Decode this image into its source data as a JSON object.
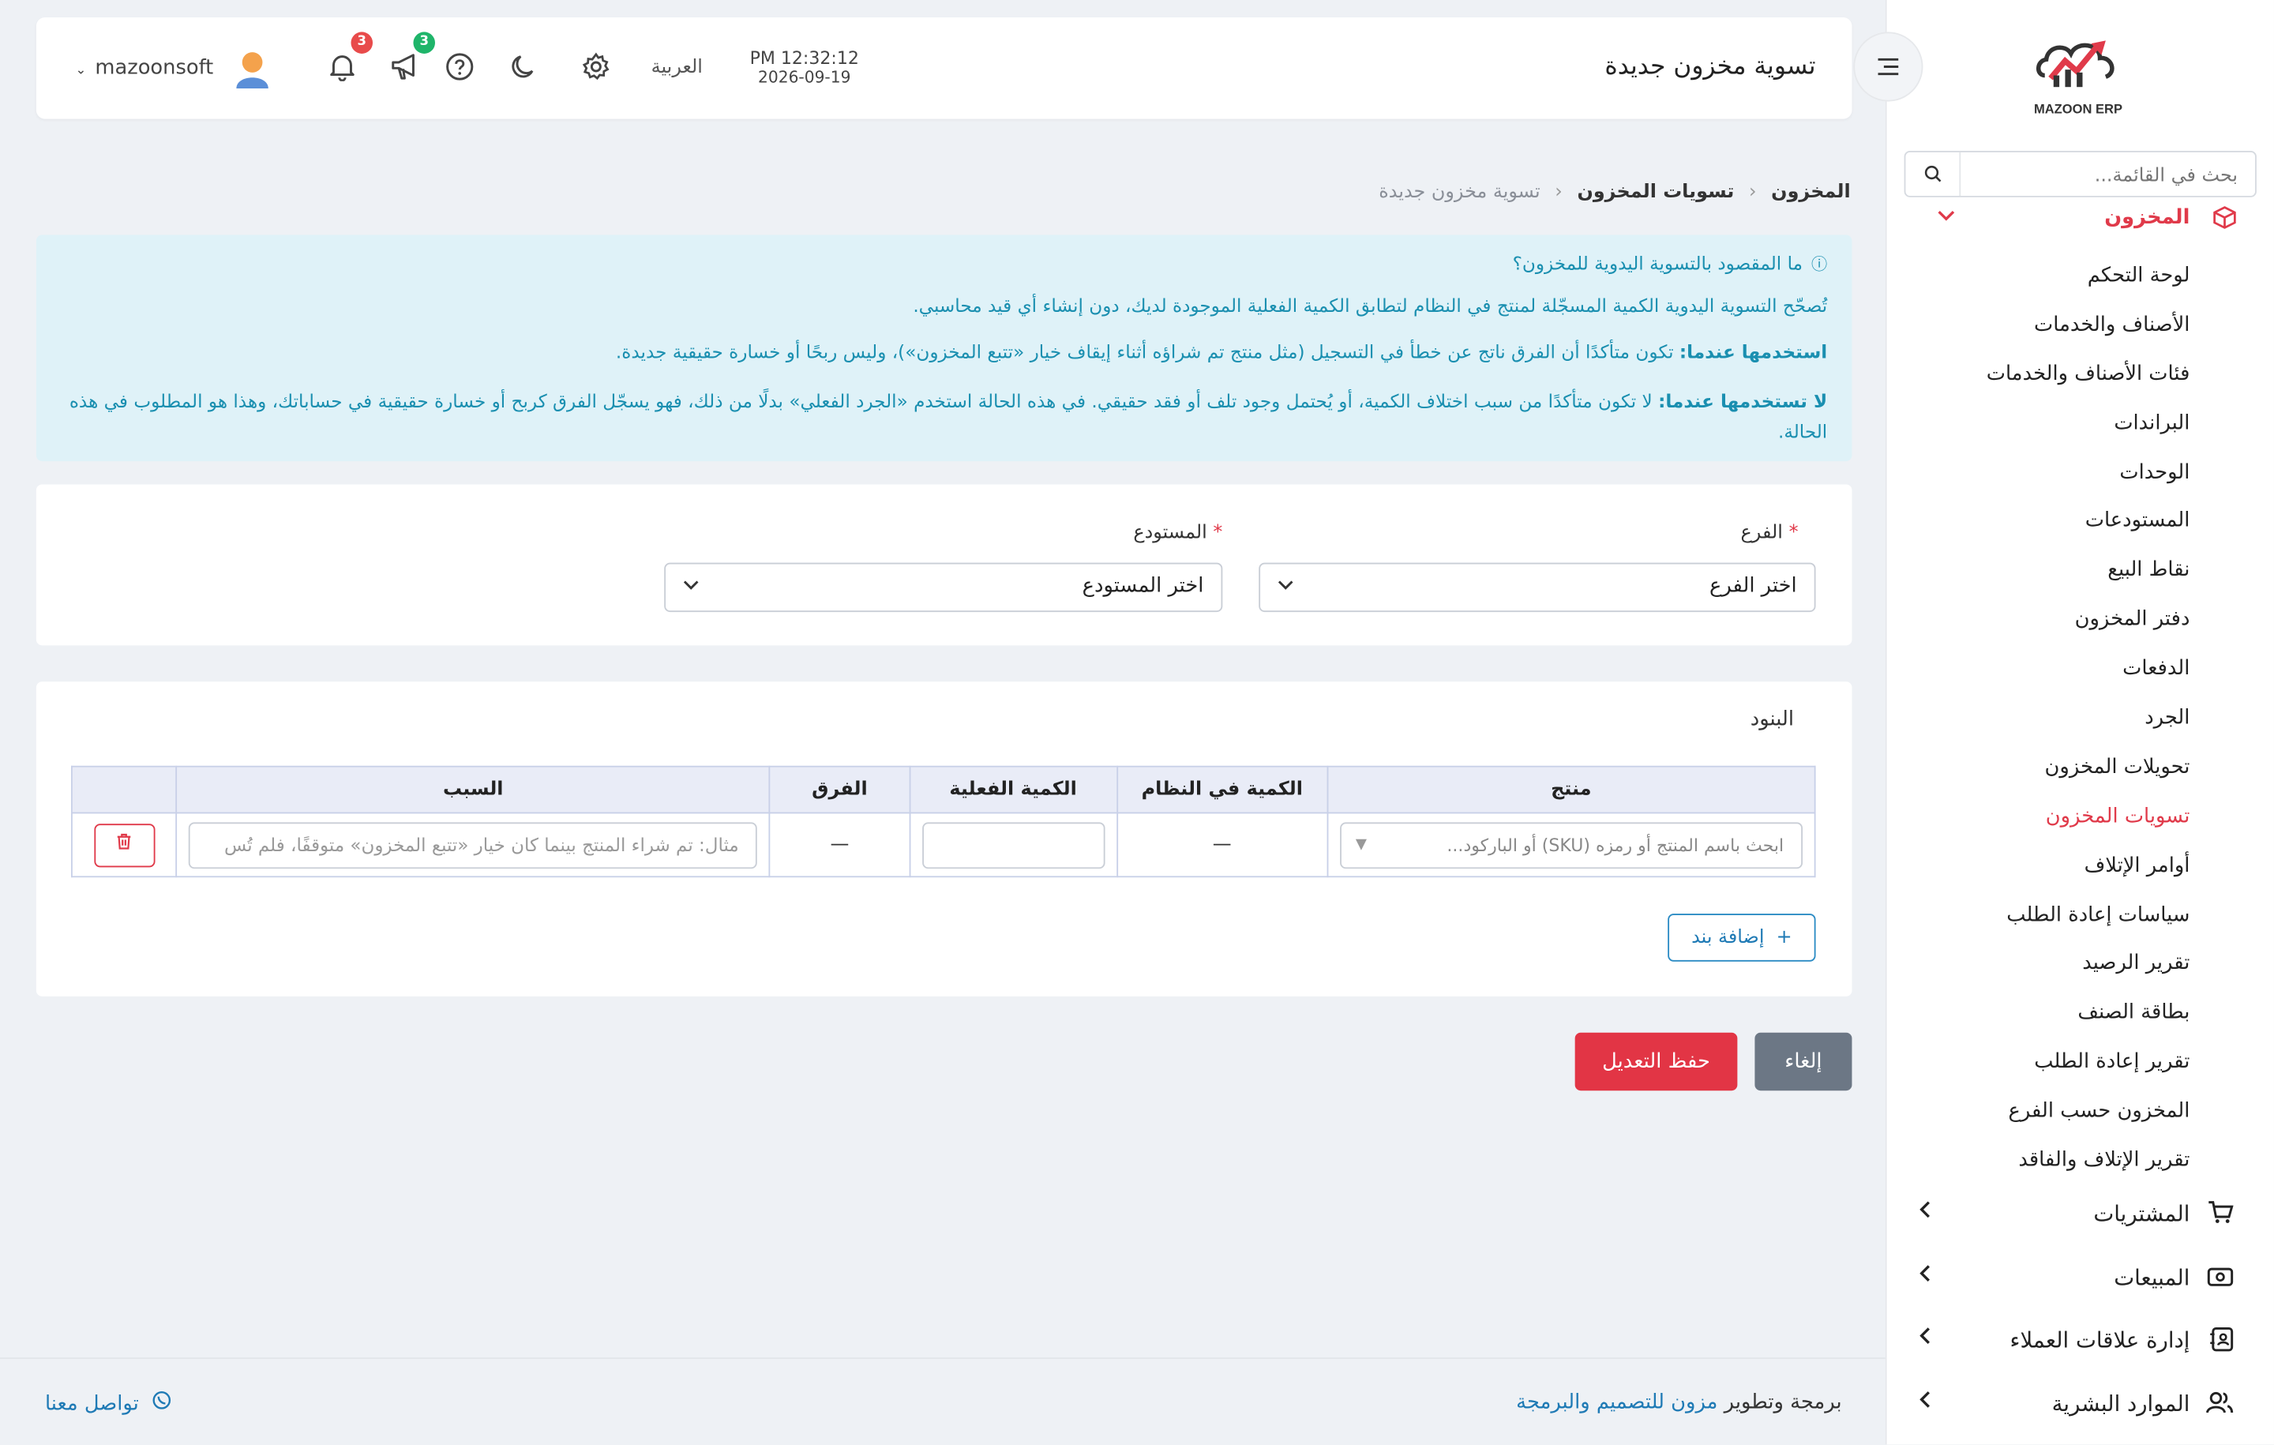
{
  "app": {
    "logo_text": "MAZOON ERP",
    "logo_sub": "ERP"
  },
  "sidebar": {
    "search_placeholder": "بحث في القائمة...",
    "section_title": "المخزون",
    "items": [
      {
        "label": "لوحة التحكم"
      },
      {
        "label": "الأصناف والخدمات"
      },
      {
        "label": "فئات الأصناف والخدمات"
      },
      {
        "label": "البراندات"
      },
      {
        "label": "الوحدات"
      },
      {
        "label": "المستودعات"
      },
      {
        "label": "نقاط البيع"
      },
      {
        "label": "دفتر المخزون"
      },
      {
        "label": "الدفعات"
      },
      {
        "label": "الجرد"
      },
      {
        "label": "تحويلات المخزون"
      },
      {
        "label": "تسويات المخزون"
      },
      {
        "label": "أوامر الإتلاف"
      },
      {
        "label": "سياسات إعادة الطلب"
      },
      {
        "label": "تقرير الرصيد"
      },
      {
        "label": "بطاقة الصنف"
      },
      {
        "label": "تقرير إعادة الطلب"
      },
      {
        "label": "المخزون حسب الفرع"
      },
      {
        "label": "تقرير الإتلاف والفاقد"
      }
    ],
    "active_item": "تسويات المخزون",
    "groups": [
      {
        "label": "المشتريات"
      },
      {
        "label": "المبيعات"
      },
      {
        "label": "إدارة علاقات العملاء"
      },
      {
        "label": "الموارد البشرية"
      }
    ]
  },
  "header": {
    "title": "تسوية مخزون جديدة",
    "time": "PM 12:32:12",
    "date": "2026-09-19",
    "language": "العربية",
    "announcements_count": "3",
    "notifications_count": "3",
    "username": "mazoonsoft"
  },
  "breadcrumb": {
    "level1": "المخزون",
    "level2": "تسويات المخزون",
    "level3": "تسوية مخزون جديدة"
  },
  "info": {
    "question": "ما المقصود بالتسوية اليدوية للمخزون؟",
    "line1": "تُصحّح التسوية اليدوية الكمية المسجّلة لمنتج في النظام لتطابق الكمية الفعلية الموجودة لديك، دون إنشاء أي قيد محاسبي.",
    "use_label": "استخدمها عندما:",
    "use_text": " تكون متأكدًا أن الفرق ناتج عن خطأ في التسجيل (مثل منتج تم شراؤه أثناء إيقاف خيار «تتبع المخزون»)، وليس ربحًا أو خسارة حقيقية جديدة.",
    "dont_label": "لا تستخدمها عندما:",
    "dont_text": " لا تكون متأكدًا من سبب اختلاف الكمية، أو يُحتمل وجود تلف أو فقد حقيقي. في هذه الحالة استخدم «الجرد الفعلي» بدلًا من ذلك، فهو يسجّل الفرق كربح أو خسارة حقيقية في حساباتك، وهذا هو المطلوب في هذه الحالة."
  },
  "form": {
    "branch_label": "الفرع",
    "branch_value": "اختر الفرع",
    "warehouse_label": "المستودع",
    "warehouse_value": "اختر المستودع",
    "required_mark": "*"
  },
  "items_table": {
    "title": "البنود",
    "columns": [
      "منتج",
      "الكمية في النظام",
      "الكمية الفعلية",
      "الفرق",
      "السبب"
    ],
    "row": {
      "product_placeholder": "ابحث باسم المنتج أو رمزه (SKU) أو الباركود...",
      "system_qty": "—",
      "actual_qty": "",
      "difference": "—",
      "reason_placeholder": "مثال: تم شراء المنتج بينما كان خيار «تتبع المخزون» متوقفًا، فلم تُس"
    },
    "add_button": "إضافة بند"
  },
  "actions": {
    "cancel": "إلغاء",
    "save": "حفظ التعديل"
  },
  "footer": {
    "prefix": "برمجة وتطوير ",
    "company": "مزون للتصميم والبرمجة",
    "contact": "تواصل معنا"
  },
  "colors": {
    "accent": "#e03a4a",
    "info_bg": "#dff2f8",
    "info_text": "#1a8fb0",
    "link": "#1f7ab5"
  }
}
